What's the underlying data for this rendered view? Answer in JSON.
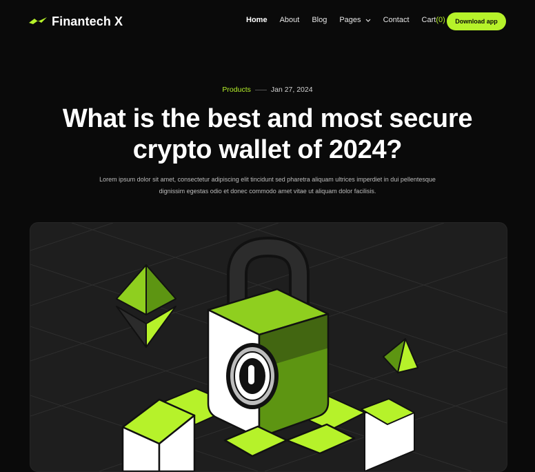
{
  "brand": {
    "name": "Finantech X"
  },
  "nav": {
    "items": [
      {
        "label": "Home",
        "active": true
      },
      {
        "label": "About"
      },
      {
        "label": "Blog"
      },
      {
        "label": "Pages",
        "has_dropdown": true
      }
    ],
    "contact_label": "Contact",
    "cart_label": "Cart",
    "cart_count": "(0)",
    "cta_label": "Download app"
  },
  "article": {
    "category": "Products",
    "date": "Jan 27, 2024",
    "title": "What is the best and most secure crypto wallet of 2024?",
    "excerpt": "Lorem ipsum dolor sit amet, consectetur adipiscing elit tincidunt sed pharetra aliquam ultrices imperdiet in dui pellentesque dignissim egestas odio et donec commodo amet vitae ut aliquam dolor facilisis."
  },
  "colors": {
    "accent": "#b6f22a",
    "background": "#0a0a0a",
    "card": "#1e1e1e"
  },
  "icons": {
    "logo": "wing-logo-icon",
    "dropdown": "chevron-down-icon",
    "hero": "padlock-crypto-illustration"
  }
}
